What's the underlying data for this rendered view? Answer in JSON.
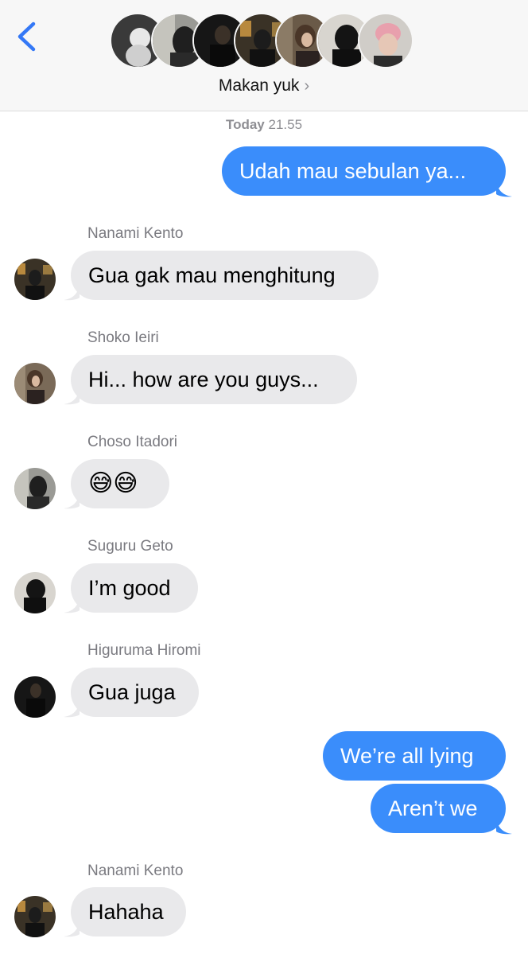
{
  "header": {
    "back_icon": "chevron-left-icon",
    "group_name": "Makan yuk",
    "chevron": "›",
    "participants": [
      "participant-1",
      "participant-2",
      "participant-3",
      "participant-4",
      "participant-5",
      "participant-6",
      "participant-7"
    ]
  },
  "timestamp": {
    "day": "Today",
    "time": "21.55"
  },
  "messages": [
    {
      "direction": "out",
      "text": "Udah mau sebulan ya..."
    },
    {
      "direction": "in",
      "sender": "Nanami Kento",
      "text": "Gua gak mau menghitung"
    },
    {
      "direction": "in",
      "sender": "Shoko Ieiri",
      "text": "Hi... how are you guys..."
    },
    {
      "direction": "in",
      "sender": "Choso Itadori",
      "text": "😅😅"
    },
    {
      "direction": "in",
      "sender": "Suguru Geto",
      "text": "I’m good"
    },
    {
      "direction": "in",
      "sender": "Higuruma Hiromi",
      "text": "Gua juga"
    },
    {
      "direction": "out",
      "text": "We’re all lying"
    },
    {
      "direction": "out",
      "text": "Aren’t we"
    },
    {
      "direction": "in",
      "sender": "Nanami Kento",
      "text": "Hahaha"
    }
  ],
  "colors": {
    "outgoing": "#3a8dfb",
    "incoming": "#e9e9eb",
    "accent": "#3478f6"
  }
}
